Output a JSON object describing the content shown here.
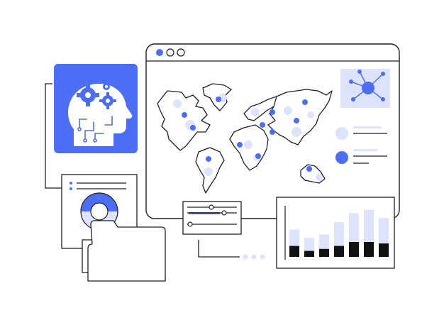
{
  "colors": {
    "accent": "#4c6ef5",
    "accent_light": "#dde3fb",
    "stroke": "#1f1f1f",
    "fill_dark": "#111111",
    "background": "#ffffff"
  },
  "browser_window": {
    "dots": [
      "filled",
      "outline",
      "outline"
    ],
    "map": {
      "continents": [
        "north-america",
        "south-america",
        "europe",
        "africa",
        "asia",
        "australia",
        "greenland"
      ]
    },
    "network_badge": {
      "icon": "network-node-icon"
    },
    "legend": [
      {
        "marker": "light-circle",
        "lines": 2
      },
      {
        "marker": "accent-circle",
        "lines": 2
      }
    ]
  },
  "ai_head_card": {
    "icon": "brain-gears-icon"
  },
  "document_card": {
    "chart": "donut-chart-icon",
    "text_lines": 2
  },
  "folder": {
    "icon": "folder-icon"
  },
  "filter_panel": {
    "icon": "sliders-icon",
    "sliders": 3
  },
  "pagination_dots": 3,
  "bar_chart": {
    "bars": [
      {
        "light": 0.55,
        "dark": 0.22
      },
      {
        "light": 0.38,
        "dark": 0.12
      },
      {
        "light": 0.45,
        "dark": 0.16
      },
      {
        "light": 0.7,
        "dark": 0.22
      },
      {
        "light": 0.88,
        "dark": 0.3
      },
      {
        "light": 0.95,
        "dark": 0.3
      },
      {
        "light": 0.78,
        "dark": 0.27
      }
    ]
  }
}
